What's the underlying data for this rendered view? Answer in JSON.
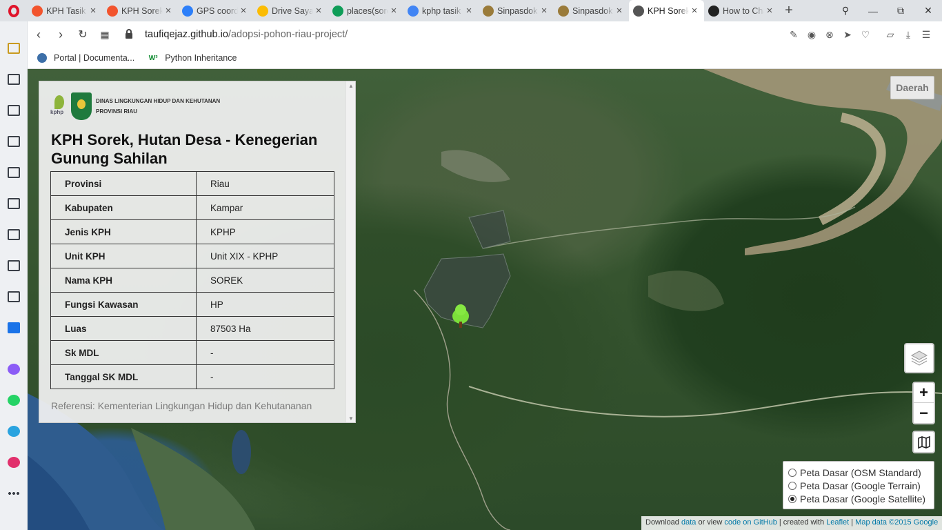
{
  "tabs": [
    {
      "label": "KPH Tasik Bes",
      "icon": "opera-red-icon",
      "color": "#f2542d"
    },
    {
      "label": "KPH Sorek",
      "icon": "opera-red-icon",
      "color": "#f2542d"
    },
    {
      "label": "GPS coordinates",
      "icon": "gps-icon",
      "color": "#2d7ff9"
    },
    {
      "label": "Drive Saya",
      "icon": "drive-icon",
      "color": "#fbbc04"
    },
    {
      "label": "places(sorek)",
      "icon": "sheets-icon",
      "color": "#0f9d58"
    },
    {
      "label": "kphp tasik",
      "icon": "google-icon",
      "color": "#4285f4"
    },
    {
      "label": "Sinpasdok",
      "icon": "sinpasdok-icon",
      "color": "#9a7b3a"
    },
    {
      "label": "Sinpasdok",
      "icon": "sinpasdok-icon",
      "color": "#9a7b3a"
    },
    {
      "label": "KPH Sorek",
      "icon": "globe-icon",
      "color": "#555555",
      "active": true
    },
    {
      "label": "How to Change",
      "icon": "nyt-icon",
      "color": "#222222"
    }
  ],
  "addressbar": {
    "domain": "taufiqejaz.github.io",
    "path": "/adopsi-pohon-riau-project/"
  },
  "bookmarks": [
    {
      "label": "Portal | Documenta...",
      "icon": "portal-icon"
    },
    {
      "label": "Python Inheritance",
      "icon": "w3schools-icon"
    }
  ],
  "sidebar_icons": [
    "wallet-icon",
    "notes-icon",
    "briefcase-icon",
    "document-icon",
    "player-icon",
    "monitor-icon",
    "chart-icon",
    "gamepad-icon",
    "report-icon",
    "calendar-icon",
    "messenger-icon",
    "whatsapp-icon",
    "telegram-icon",
    "instagram-icon",
    "more-icon"
  ],
  "panel": {
    "logo_text_line1": "DINAS LINGKUNGAN HIDUP DAN KEHUTANAN",
    "logo_text_line2": "PROVINSI RIAU",
    "logo_kphp_text": "kphp",
    "title": "KPH Sorek, Hutan Desa - Kenegerian Gunung Sahilan",
    "rows": [
      {
        "key": "Provinsi",
        "value": "Riau"
      },
      {
        "key": "Kabupaten",
        "value": "Kampar"
      },
      {
        "key": "Jenis KPH",
        "value": "KPHP"
      },
      {
        "key": "Unit KPH",
        "value": "Unit XIX - KPHP"
      },
      {
        "key": "Nama KPH",
        "value": "SOREK"
      },
      {
        "key": "Fungsi Kawasan",
        "value": "HP"
      },
      {
        "key": "Luas",
        "value": "87503 Ha"
      },
      {
        "key": "Sk MDL",
        "value": "-"
      },
      {
        "key": "Tanggal SK MDL",
        "value": "-"
      }
    ],
    "reference": "Referensi: Kementerian Lingkungan Hidup dan Kehutananan"
  },
  "map": {
    "daerah_label": "Daerah",
    "zoom_in": "+",
    "zoom_out": "−",
    "basemaps": [
      {
        "label": "Peta Dasar (OSM Standard)",
        "selected": false
      },
      {
        "label": "Peta Dasar (Google Terrain)",
        "selected": false
      },
      {
        "label": "Peta Dasar (Google Satellite)",
        "selected": true
      }
    ],
    "attribution": {
      "t1": "Download ",
      "l1": "data",
      "t2": " or view ",
      "l2": "code on GitHub",
      "t3": " | created with ",
      "l3": "Leaflet",
      "t4": " | ",
      "l4": "Map data ©2015 Google"
    },
    "marker_color": "#7ce03a"
  }
}
